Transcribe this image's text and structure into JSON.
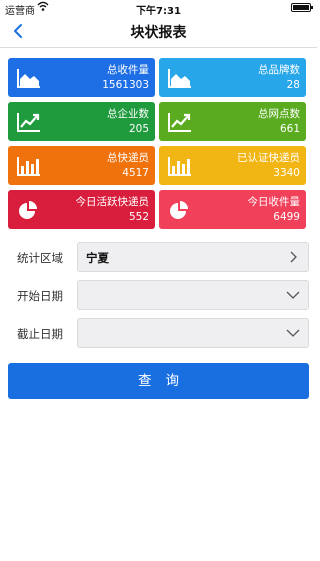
{
  "status_bar": {
    "carrier": "运营商",
    "time": "下午7:31"
  },
  "navbar": {
    "title": "块状报表"
  },
  "tiles": [
    {
      "label": "总收件量",
      "value": "1561303",
      "color": "#1e6fe6",
      "icon": "area-chart-icon"
    },
    {
      "label": "总品牌数",
      "value": "28",
      "color": "#27a6ea",
      "icon": "area-chart-icon"
    },
    {
      "label": "总企业数",
      "value": "205",
      "color": "#1f9a3d",
      "icon": "line-chart-icon"
    },
    {
      "label": "总网点数",
      "value": "661",
      "color": "#5aab1f",
      "icon": "line-chart-icon"
    },
    {
      "label": "总快递员",
      "value": "4517",
      "color": "#f0720c",
      "icon": "bar-chart-icon"
    },
    {
      "label": "已认证快递员",
      "value": "3340",
      "color": "#f2b614",
      "icon": "bar-chart-icon"
    },
    {
      "label": "今日活跃快递员",
      "value": "552",
      "color": "#d81e3c",
      "icon": "pie-chart-icon"
    },
    {
      "label": "今日收件量",
      "value": "6499",
      "color": "#f0405a",
      "icon": "pie-chart-icon"
    }
  ],
  "form": {
    "region_label": "统计区域",
    "region_value": "宁夏",
    "start_label": "开始日期",
    "end_label": "截止日期"
  },
  "query_button": "查询"
}
